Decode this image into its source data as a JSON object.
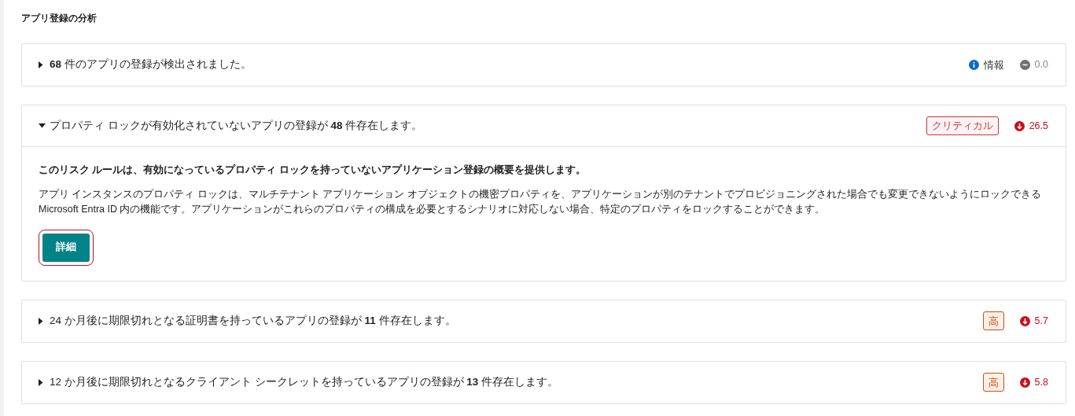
{
  "heading": "アプリ登録の分析",
  "findings": [
    {
      "title": "**68** 件のアプリの登録が検出されました。",
      "expanded": false,
      "severity": {
        "kind": "info",
        "label": "情報"
      },
      "score": {
        "kind": "neutral",
        "value": "0.0"
      }
    },
    {
      "title": "プロパティ ロックが有効化されていないアプリの登録が **48** 件存在します。",
      "expanded": true,
      "severity": {
        "kind": "critical",
        "label": "クリティカル"
      },
      "score": {
        "kind": "down",
        "value": "26.5"
      },
      "summary": "このリスク ルールは、有効になっているプロパティ ロックを持っていないアプリケーション登録の概要を提供します。",
      "description": "アプリ インスタンスのプロパティ ロックは、マルチテナント アプリケーション オブジェクトの機密プロパティを、アプリケーションが別のテナントでプロビジョニングされた場合でも変更できないようにロックできる Microsoft Entra ID 内の機能です。アプリケーションがこれらのプロパティの構成を必要とするシナリオに対応しない場合、特定のプロパティをロックすることができます。",
      "button": {
        "label": "詳細",
        "focused": true
      }
    },
    {
      "title": "24 か月後に期限切れとなる証明書を持っているアプリの登録が **11** 件存在します。",
      "expanded": false,
      "severity": {
        "kind": "high",
        "label": "高"
      },
      "score": {
        "kind": "down",
        "value": "5.7"
      }
    },
    {
      "title": "12 か月後に期限切れとなるクライアント シークレットを持っているアプリの登録が **13** 件存在します。",
      "expanded": false,
      "severity": {
        "kind": "high",
        "label": "高"
      },
      "score": {
        "kind": "down",
        "value": "5.8"
      }
    }
  ]
}
